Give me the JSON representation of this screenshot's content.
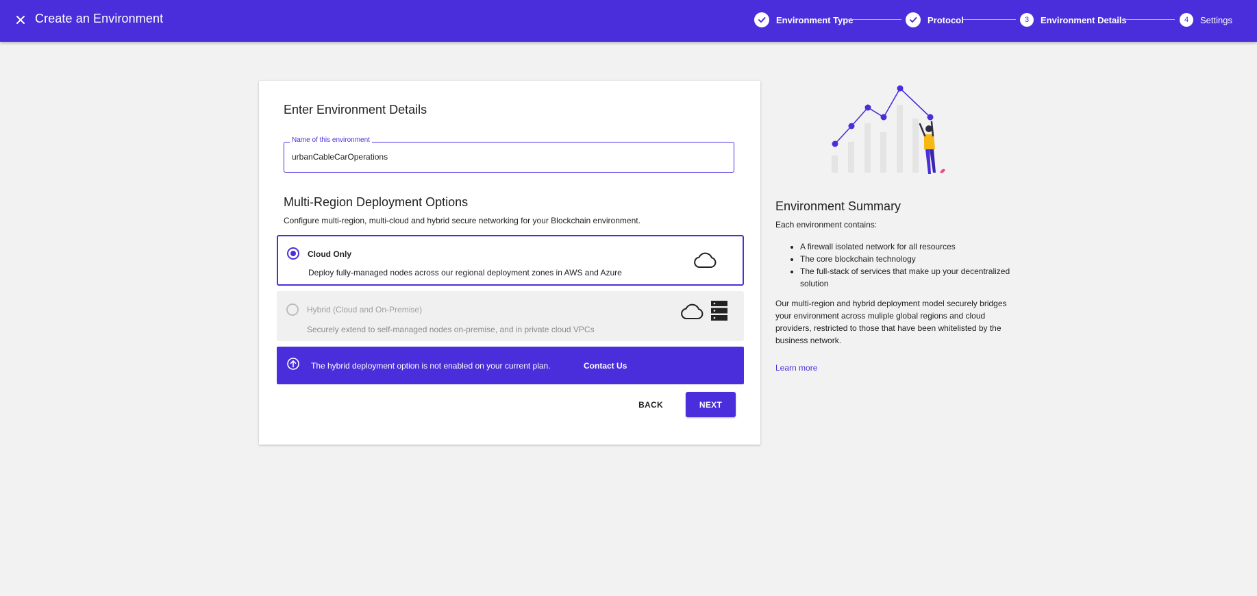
{
  "header": {
    "title": "Create an Environment",
    "steps": [
      {
        "label": "Environment Type",
        "status": "complete",
        "number": "1"
      },
      {
        "label": "Protocol",
        "status": "complete",
        "number": "2"
      },
      {
        "label": "Environment Details",
        "status": "active",
        "number": "3"
      },
      {
        "label": "Settings",
        "status": "pending",
        "number": "4"
      }
    ]
  },
  "form": {
    "title": "Enter Environment Details",
    "name_field": {
      "label": "Name of this environment",
      "value": "urbanCableCarOperations"
    },
    "deployment": {
      "title": "Multi-Region Deployment Options",
      "description": "Configure multi-region, multi-cloud and hybrid secure networking for your Blockchain environment.",
      "options": [
        {
          "title": "Cloud Only",
          "description": "Deploy fully-managed nodes across our regional deployment zones in AWS and Azure",
          "selected": true,
          "enabled": true,
          "icons": [
            "cloud-icon"
          ]
        },
        {
          "title": "Hybrid (Cloud and On-Premise)",
          "description": "Securely extend to self-managed nodes on-premise, and in private cloud VPCs",
          "selected": false,
          "enabled": false,
          "icons": [
            "cloud-icon",
            "server-icon"
          ]
        }
      ]
    },
    "banner": {
      "text": "The hybrid deployment option is not enabled on your current plan.",
      "link": "Contact Us"
    },
    "back_label": "BACK",
    "next_label": "NEXT"
  },
  "summary": {
    "title": "Environment Summary",
    "intro": "Each environment contains:",
    "items": [
      "A firewall isolated network for all resources",
      "The core blockchain technology",
      "The full-stack of services that make up your decentralized solution"
    ],
    "paragraph": "Our multi-region and hybrid deployment model securely bridges your environment across muliple global regions and cloud providers, restricted to those that have been whitelisted by the business network.",
    "learn_more": "Learn more"
  },
  "colors": {
    "accent": "#4a2edb",
    "background": "#f2f2f2",
    "illustration_accent": "#f6b814"
  }
}
